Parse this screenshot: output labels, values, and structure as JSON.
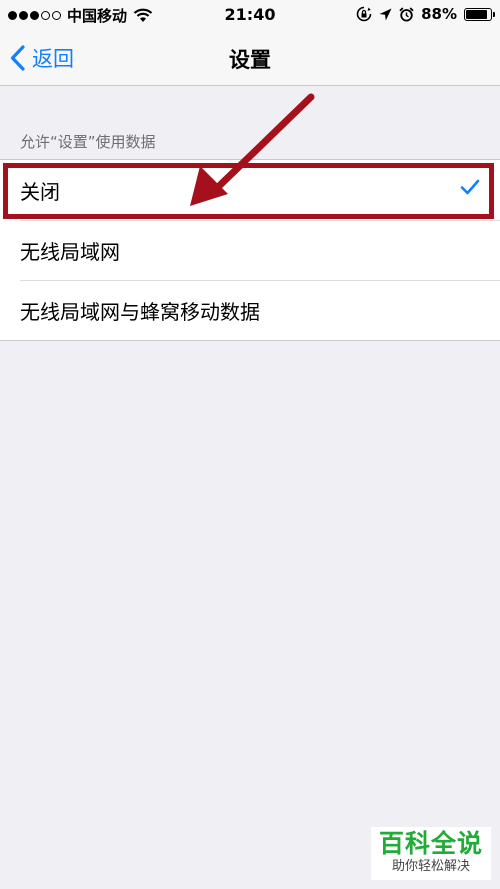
{
  "status_bar": {
    "carrier": "中国移动",
    "time": "21:40",
    "battery_percent": "88%",
    "battery_level": 0.88,
    "icons": [
      "signal-dots-icon",
      "wifi-icon",
      "orientation-lock-icon",
      "location-arrow-icon",
      "alarm-icon",
      "battery-icon"
    ]
  },
  "nav": {
    "back_label": "返回",
    "title": "设置"
  },
  "section": {
    "header": "允许“设置”使用数据",
    "options": [
      {
        "label": "关闭",
        "selected": true
      },
      {
        "label": "无线局域网",
        "selected": false
      },
      {
        "label": "无线局域网与蜂窝移动数据",
        "selected": false
      }
    ]
  },
  "colors": {
    "accent": "#157efb",
    "annotation": "#a4101c",
    "background": "#efeff4",
    "watermark": "#22ab38"
  },
  "watermark": {
    "title": "百科全说",
    "subtitle": "助你轻松解决"
  }
}
